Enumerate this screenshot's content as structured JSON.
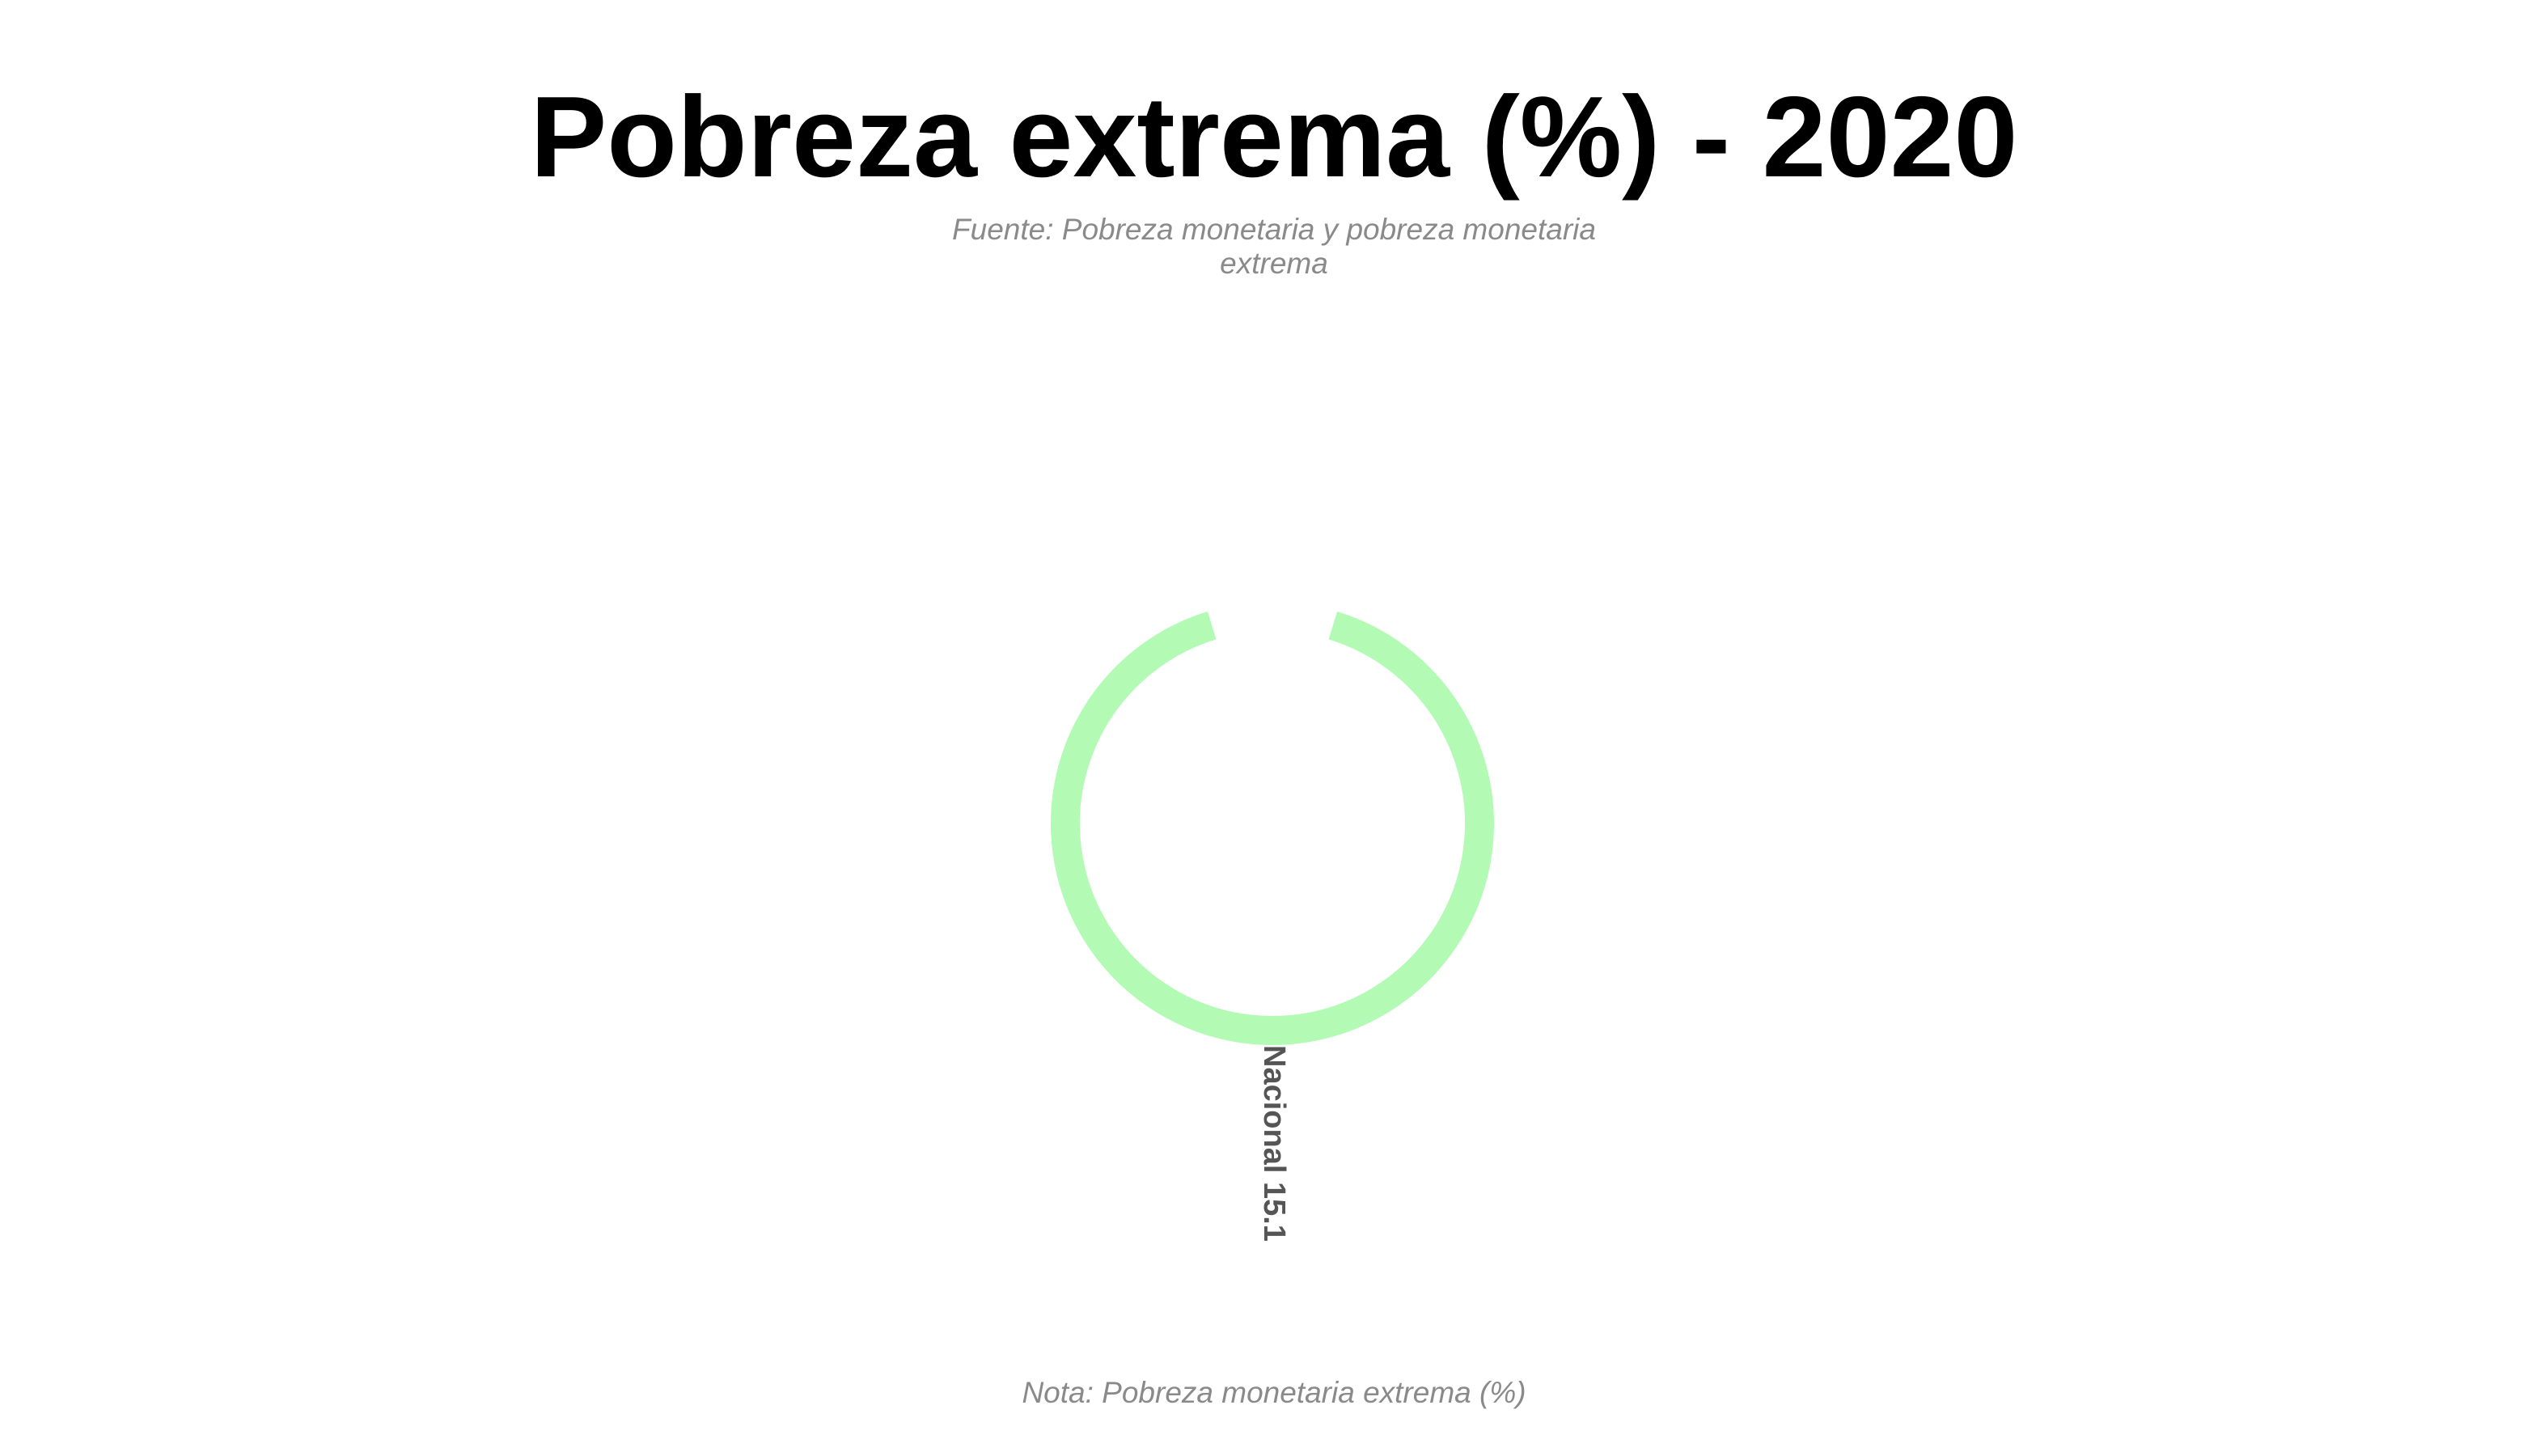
{
  "header": {
    "title": "Pobreza extrema (%) - 2020",
    "subtitle": "Fuente: Pobreza monetaria y pobreza monetaria extrema"
  },
  "footer": {
    "note": "Nota: Pobreza monetaria extrema (%)"
  },
  "colors": {
    "arc": "#b3fbb5",
    "label": "#555555",
    "title": "#000000",
    "muted": "#8a8a8a"
  },
  "chart_data": {
    "type": "pie",
    "title": "Pobreza extrema (%) - 2020",
    "subtitle": "Fuente: Pobreza monetaria y pobreza monetaria extrema",
    "note": "Nota: Pobreza monetaria extrema (%)",
    "categories": [
      "Nacional"
    ],
    "values": [
      15.1
    ],
    "labels": [
      "Nacional 15.1"
    ],
    "legend": "none"
  }
}
